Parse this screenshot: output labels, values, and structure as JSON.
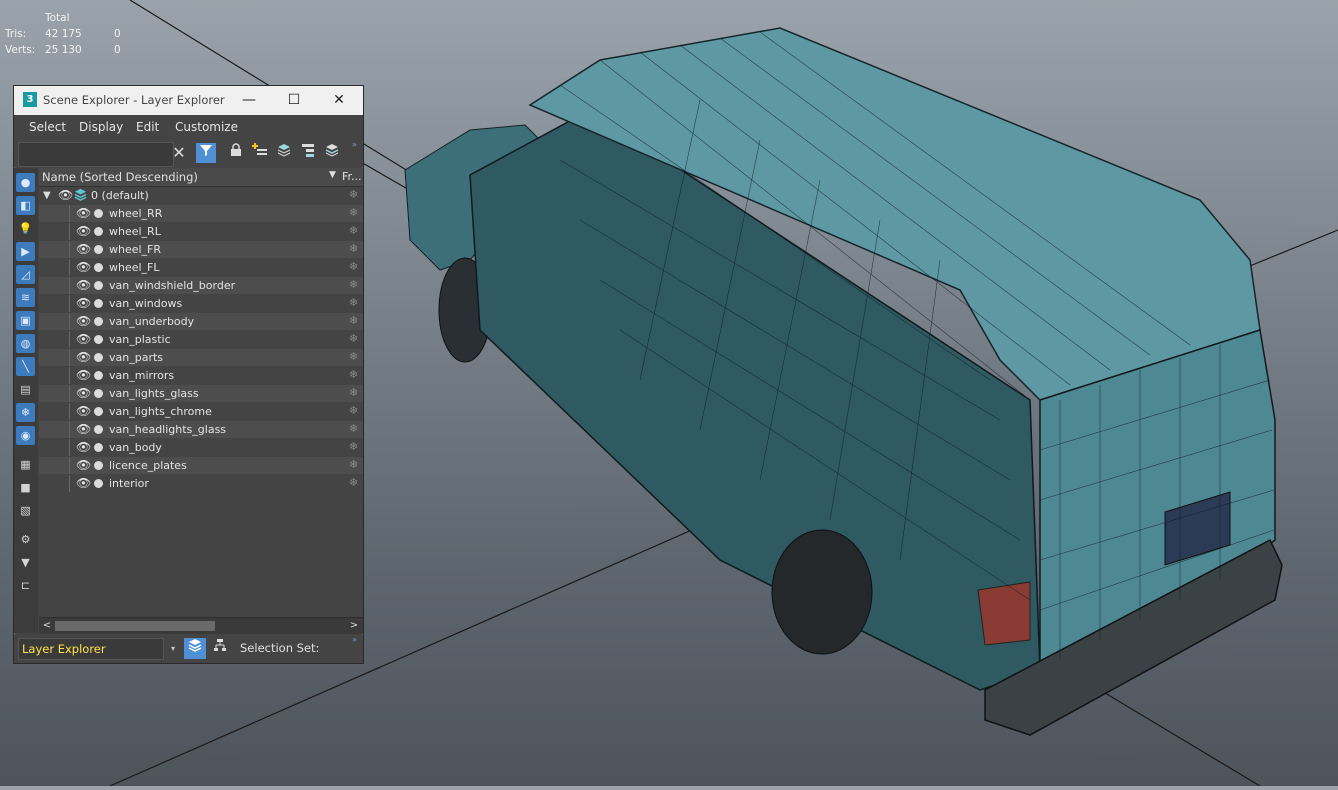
{
  "stats": {
    "header": "Total",
    "rows": [
      {
        "label": "Tris:",
        "total": "42 175",
        "selected": "0"
      },
      {
        "label": "Verts:",
        "total": "25 130",
        "selected": "0"
      }
    ]
  },
  "window": {
    "app_icon": "3",
    "title": "Scene Explorer - Layer Explorer",
    "minimize": "—",
    "maximize": "☐",
    "close": "✕"
  },
  "menu": {
    "items": [
      "Select",
      "Display",
      "Edit",
      "Customize"
    ]
  },
  "toolbar": {
    "search_value": "",
    "clear": "✕",
    "icons": [
      "filter-icon",
      "lock-icon",
      "add-layer-icon",
      "layers-icon",
      "hierarchy-icon",
      "layer-stack-icon"
    ]
  },
  "columns": {
    "name": "Name (Sorted Descending)",
    "sort_indicator": "▼",
    "frozen": "Fr..."
  },
  "tree": {
    "root": {
      "label": "0 (default)"
    },
    "layers": [
      "wheel_RR",
      "wheel_RL",
      "wheel_FR",
      "wheel_FL",
      "van_windshield_border",
      "van_windows",
      "van_underbody",
      "van_plastic",
      "van_parts",
      "van_mirrors",
      "van_lights_glass",
      "van_lights_chrome",
      "van_headlights_glass",
      "van_body",
      "licence_plates",
      "interior"
    ]
  },
  "scrollbar": {
    "left": "<",
    "right": ">"
  },
  "bottom": {
    "explorer_select": "Layer Explorer",
    "selection_set_label": "Selection Set:"
  },
  "colors": {
    "accent": "#4f8fd4",
    "panel": "#444444",
    "highlight_text": "#ffe34a",
    "van_body": "#4e8892"
  }
}
